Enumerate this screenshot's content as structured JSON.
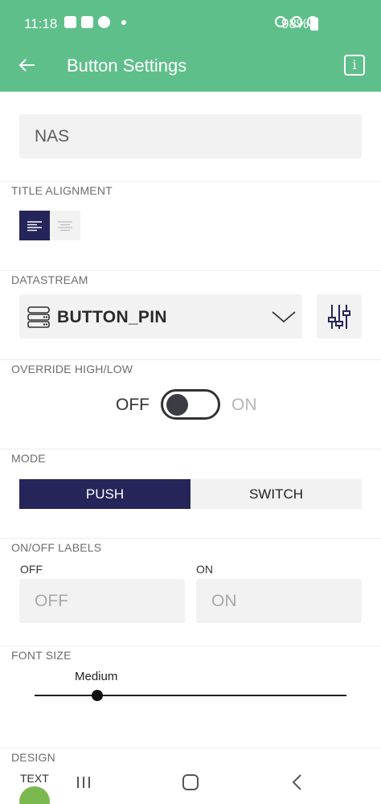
{
  "status_bar": {
    "time": "11:18",
    "battery": "98%"
  },
  "header": {
    "title": "Button Settings",
    "info_icon": "i"
  },
  "name_field": {
    "value": "NAS"
  },
  "title_alignment": {
    "label": "TITLE ALIGNMENT",
    "selected": "left"
  },
  "datastream": {
    "label": "DATASTREAM",
    "value": "BUTTON_PIN"
  },
  "override": {
    "label": "OVERRIDE HIGH/LOW",
    "off_label": "OFF",
    "on_label": "ON",
    "state": "off"
  },
  "mode": {
    "label": "MODE",
    "options": [
      "PUSH",
      "SWITCH"
    ],
    "selected": "PUSH"
  },
  "onoff_labels": {
    "label": "ON/OFF LABELS",
    "off_caption": "OFF",
    "on_caption": "ON",
    "off_placeholder": "OFF",
    "on_placeholder": "ON"
  },
  "font_size": {
    "label": "FONT SIZE",
    "value": "Medium",
    "level": 0.2
  },
  "design": {
    "label": "DESIGN",
    "text_label": "TEXT",
    "text_color": "#7ab94f"
  },
  "colors": {
    "accent": "#5fbf8b",
    "selected": "#25255a",
    "field_bg": "#f1f2f1"
  }
}
